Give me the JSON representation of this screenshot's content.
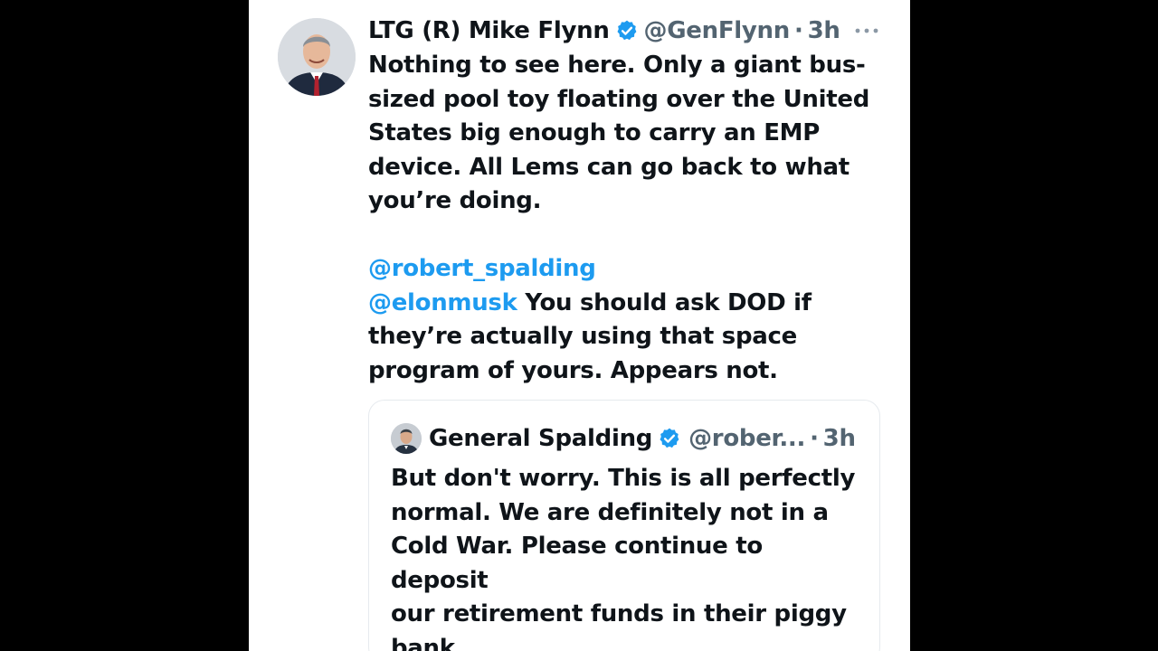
{
  "tweet": {
    "display_name": "LTG (R) Mike Flynn",
    "handle": "@GenFlynn",
    "separator": "·",
    "time": "3h",
    "more_icon": "ellipsis-icon",
    "verified_icon": "verified-badge-icon",
    "text_lines": [
      "Nothing to see here. Only a giant bus-",
      "sized pool toy floating over the United",
      "States big enough to carry an EMP",
      "device. All Lems can go back to what",
      "you’re doing."
    ],
    "mention_1": "@robert_spalding",
    "mention_2": "@elonmusk",
    "mention_2_after": " You should ask DOD if",
    "reply_lines": [
      "they’re actually using that space",
      "program of yours. Appears not."
    ]
  },
  "quote": {
    "display_name": "General Spalding",
    "handle": "@rober...",
    "separator": "·",
    "time": "3h",
    "text_lines": [
      "But don't worry. This is all perfectly",
      "normal. We are definitely not in a",
      "Cold War. Please continue to deposit",
      "our retirement funds in their piggy",
      "bank…."
    ]
  },
  "colors": {
    "background": "#000000",
    "card": "#ffffff",
    "text": "#0f1419",
    "secondary": "#536471",
    "accent": "#1d9bf0"
  }
}
